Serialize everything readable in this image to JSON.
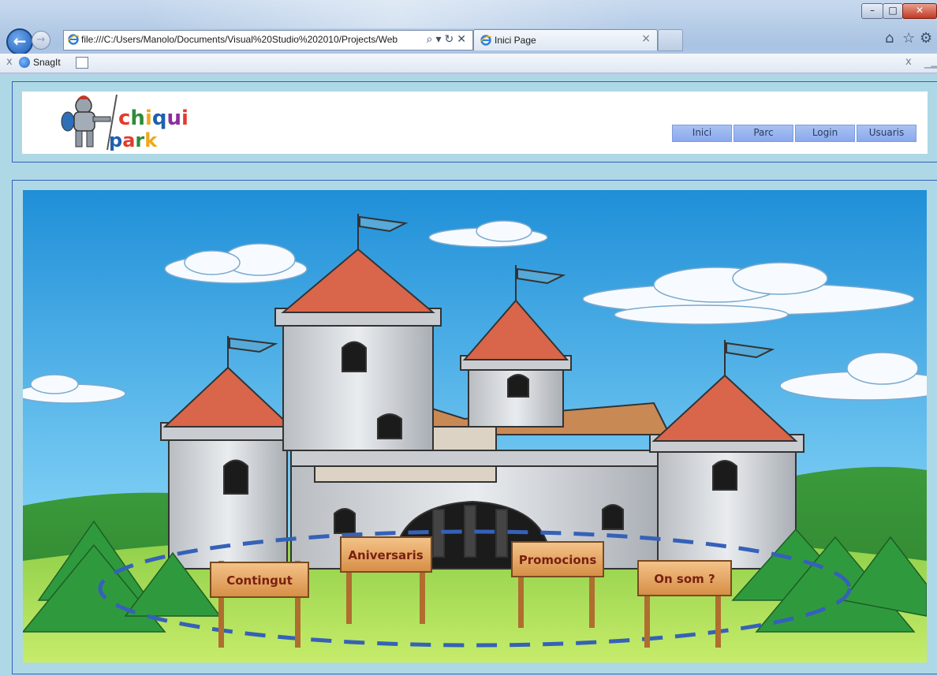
{
  "browser": {
    "address_url": "file:///C:/Users/Manolo/Documents/Visual%20Studio%202010/Projects/Web",
    "tab_title": "Inici Page",
    "favorites": {
      "snagit_label": "SnagIt"
    }
  },
  "header": {
    "logo_text_line1": "chiqui",
    "logo_text_line2": "park",
    "nav": [
      {
        "label": "Inici"
      },
      {
        "label": "Parc"
      },
      {
        "label": "Login"
      },
      {
        "label": "Usuaris"
      }
    ]
  },
  "main": {
    "signs": [
      {
        "label": "Contingut"
      },
      {
        "label": "Aniversaris"
      },
      {
        "label": "Promocions"
      },
      {
        "label": "On som ?"
      }
    ]
  },
  "colors": {
    "page_bg": "#aed8e6",
    "panel_border": "#3561b8",
    "nav_button": "#94b0f0",
    "sign_text": "#7a2010",
    "dashed_ellipse": "#3561b8"
  }
}
